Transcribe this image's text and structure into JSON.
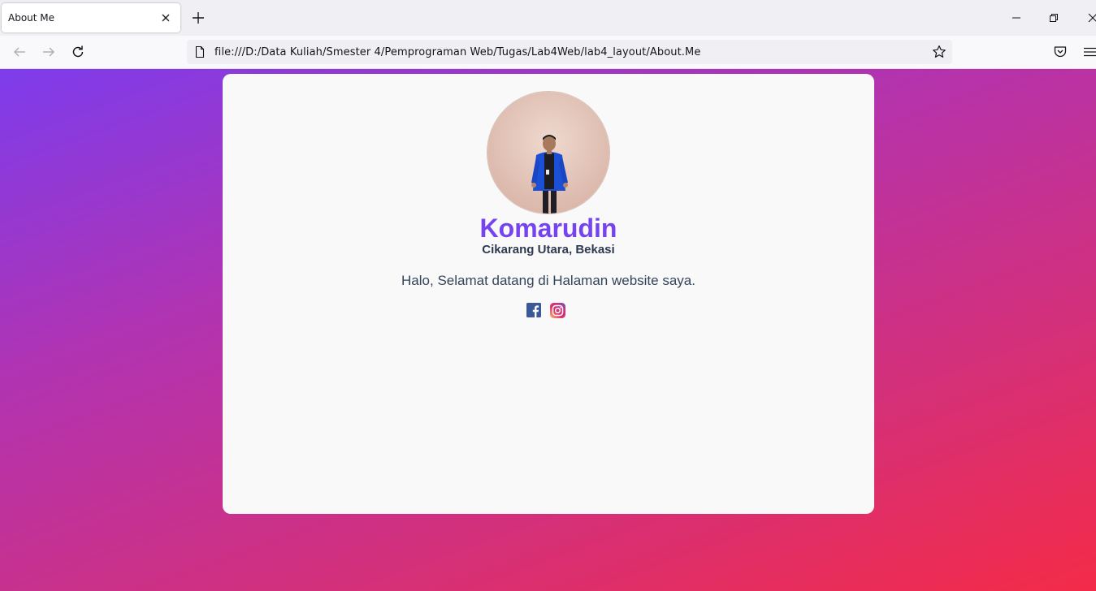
{
  "browser": {
    "tab": {
      "title": "About Me"
    },
    "url": "file:///D:/Data Kuliah/Smester 4/Pemprograman Web/Tugas/Lab4Web/lab4_layout/About.Me"
  },
  "profile": {
    "name": "Komarudin",
    "location": "Cikarang Utara, Bekasi",
    "greeting": "Halo, Selamat datang di Halaman website saya.",
    "social": [
      "facebook-icon",
      "instagram-icon"
    ]
  },
  "colors": {
    "accent": "#7544f0",
    "gradient_start": "#7d3cec",
    "gradient_end": "#f42b48",
    "card_bg": "#f9f9f9"
  }
}
